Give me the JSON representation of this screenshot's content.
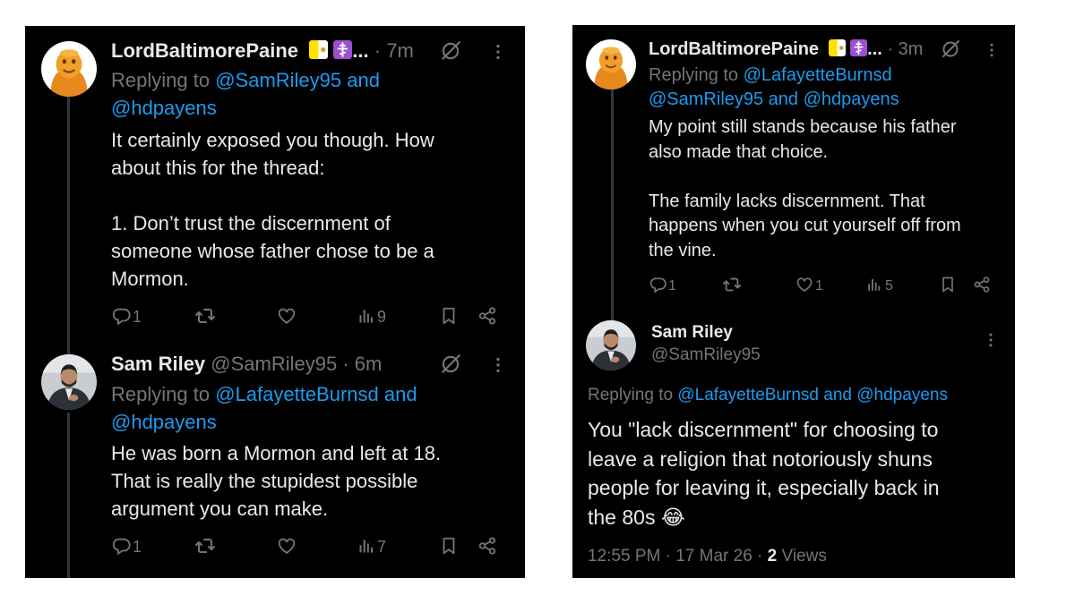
{
  "left_panel": {
    "tweet1": {
      "display_name": "LordBaltimorePaine",
      "name_suffix": "...",
      "time": "· 7m",
      "replying_prefix": "Replying to",
      "replying_line1": "@SamRiley95 and",
      "replying_line2": "@hdpayens",
      "body_lines": [
        "It certainly exposed you though. How",
        "about this for the thread:",
        "",
        "1. Don’t trust the discernment of",
        "someone whose father chose to be a",
        "Mormon."
      ],
      "replies": "1",
      "likes": "",
      "views": "9"
    },
    "tweet2": {
      "display_name": "Sam Riley",
      "handle_time": "@SamRiley95 · 6m",
      "replying_prefix": "Replying to",
      "replying_line1": "@LafayetteBurnsd and",
      "replying_line2": "@hdpayens",
      "body_lines": [
        "He was born a Mormon and left at 18.",
        "That is really the stupidest possible",
        "argument you can make."
      ],
      "replies": "1",
      "views": "7"
    }
  },
  "right_panel": {
    "tweet1": {
      "display_name": "LordBaltimorePaine",
      "name_suffix": "...",
      "time": "· 3m",
      "replying_prefix": "Replying to",
      "replying_line1": "@LafayetteBurnsd",
      "replying_line2": "@SamRiley95 and @hdpayens",
      "body_lines": [
        "My point still stands because his father",
        "also made that choice.",
        "",
        "The family lacks discernment. That",
        "happens when you cut yourself off from",
        "the vine."
      ],
      "replies": "1",
      "likes": "1",
      "views": "5"
    },
    "tweet2": {
      "display_name": "Sam Riley",
      "handle": "@SamRiley95",
      "replying_prefix": "Replying to",
      "replying_mentions": "@LafayetteBurnsd and @hdpayens",
      "body_lines": [
        "You \"lack discernment\" for choosing to",
        "leave a religion that notoriously shuns",
        "people for leaving it, especially back in",
        "the 80s"
      ],
      "emoji": "😂",
      "meta_time": "12:55 PM · 17 Mar 26 ·",
      "meta_views_count": "2",
      "meta_views_label": "Views"
    }
  },
  "colors": {
    "background": "#000000",
    "text": "#e7e9ea",
    "muted": "#71767b",
    "link": "#1d9bf0",
    "thread_line": "#333639"
  },
  "icons": [
    "reply-icon",
    "retweet-icon",
    "like-icon",
    "views-icon",
    "bookmark-icon",
    "share-icon",
    "grok-icon",
    "more-icon",
    "papal-flag-icon",
    "orthodox-cross-icon"
  ]
}
